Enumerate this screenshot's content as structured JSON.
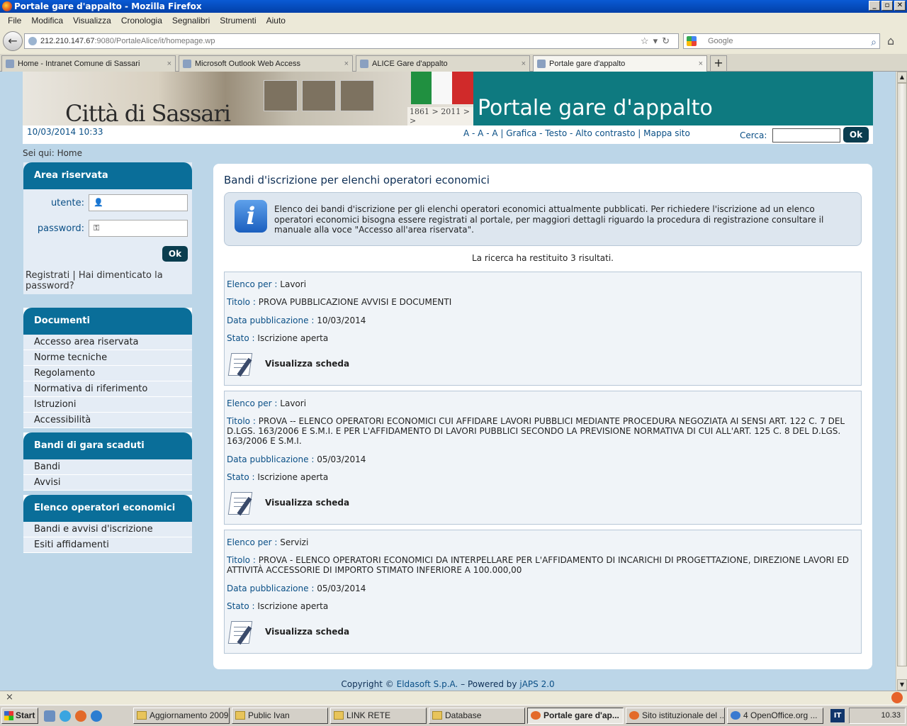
{
  "window": {
    "title": "Portale gare d'appalto - Mozilla Firefox"
  },
  "menu": [
    "File",
    "Modifica",
    "Visualizza",
    "Cronologia",
    "Segnalibri",
    "Strumenti",
    "Aiuto"
  ],
  "address": {
    "host": "212.210.147.67",
    "rest": ":9080/PortaleAlice/it/homepage.wp"
  },
  "search": {
    "placeholder": "Google"
  },
  "tabs": [
    {
      "label": "Home - Intranet Comune di Sassari",
      "close": "×"
    },
    {
      "label": "Microsoft Outlook Web Access",
      "close": "×"
    },
    {
      "label": "ALICE Gare d'appalto",
      "close": "×"
    },
    {
      "label": "Portale gare d'appalto",
      "close": "×"
    }
  ],
  "newtab": "+",
  "header": {
    "city_logo": "Città di Sassari",
    "anniversary": "1861 > 2011 > >",
    "portal_title": "Portale gare d'appalto",
    "datetime": "10/03/2014 10:33",
    "access_links": "A - A - A | Grafica - Testo - Alto contrasto | Mappa sito",
    "search_label": "Cerca:",
    "search_ok": "Ok"
  },
  "breadcrumb": "Sei qui: Home",
  "login": {
    "title": "Area riservata",
    "user_label": "utente:",
    "password_label": "password:",
    "ok": "Ok",
    "links": "Registrati | Hai dimenticato la password?"
  },
  "documenti": {
    "title": "Documenti",
    "items": [
      "Accesso area riservata",
      "Norme tecniche",
      "Regolamento",
      "Normativa di riferimento",
      "Istruzioni",
      "Accessibilità"
    ]
  },
  "bandi_scaduti": {
    "title": "Bandi di gara scaduti",
    "items": [
      "Bandi",
      "Avvisi"
    ]
  },
  "elenco_operatori": {
    "title": "Elenco operatori economici",
    "items": [
      "Bandi e avvisi d'iscrizione",
      "Esiti affidamenti"
    ]
  },
  "main": {
    "heading": "Bandi d'iscrizione per elenchi operatori economici",
    "info": "Elenco dei bandi d'iscrizione per gli elenchi operatori economici attualmente pubblicati. Per richiedere l'iscrizione ad un elenco operatori economici bisogna essere registrati al portale, per maggiori dettagli riguardo la procedura di registrazione consultare il manuale alla voce \"Accesso all'area riservata\".",
    "result_count": "La ricerca ha restituito 3 risultati.",
    "labels": {
      "elenco": "Elenco per :",
      "titolo": "Titolo :",
      "data": "Data pubblicazione :",
      "stato": "Stato :",
      "view": "Visualizza scheda"
    },
    "results": [
      {
        "elenco": "Lavori",
        "titolo": "PROVA PUBBLICAZIONE AVVISI E DOCUMENTI",
        "data": "10/03/2014",
        "stato": "Iscrizione aperta"
      },
      {
        "elenco": "Lavori",
        "titolo": "PROVA -- ELENCO OPERATORI ECONOMICI CUI AFFIDARE LAVORI PUBBLICI MEDIANTE PROCEDURA NEGOZIATA AI SENSI ART. 122 C. 7 DEL D.LGS. 163/2006 E S.M.I. E PER L'AFFIDAMENTO DI LAVORI PUBBLICI SECONDO LA PREVISIONE NORMATIVA DI CUI ALL'ART. 125 C. 8 DEL D.LGS. 163/2006 E S.M.I.",
        "data": "05/03/2014",
        "stato": "Iscrizione aperta"
      },
      {
        "elenco": "Servizi",
        "titolo": "PROVA - ELENCO OPERATORI ECONOMICI DA INTERPELLARE PER L'AFFIDAMENTO DI INCARICHI DI PROGETTAZIONE, DIREZIONE LAVORI ED ATTIVITÀ ACCESSORIE DI IMPORTO STIMATO INFERIORE A  100.000,00",
        "data": "05/03/2014",
        "stato": "Iscrizione aperta"
      }
    ]
  },
  "footer": {
    "pre": "Copyright ©",
    "company": "Eldasoft S.p.A.",
    "mid": "– Powered by",
    "engine": "jAPS 2.0"
  },
  "statusbar": {
    "close": "×"
  },
  "taskbar": {
    "start": "Start",
    "tasks": [
      "Aggiornamento 2009",
      "Public Ivan",
      "LINK RETE",
      "Database",
      "Portale gare d'ap...",
      "Sito istituzionale del ...",
      "4 OpenOffice.org ..."
    ],
    "lang": "IT",
    "clock": "10.33"
  }
}
